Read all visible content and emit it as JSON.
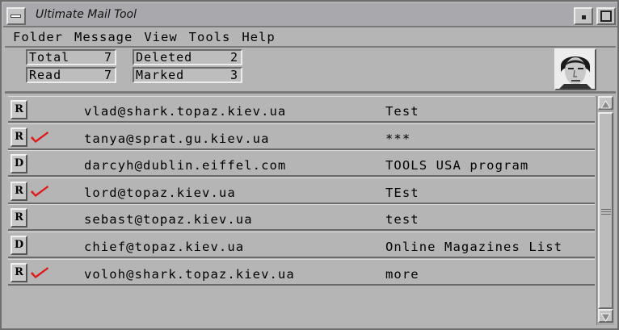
{
  "window": {
    "title": "Ultimate Mail Tool"
  },
  "menu": [
    "Folder",
    "Message",
    "View",
    "Tools",
    "Help"
  ],
  "stats": {
    "total_label": "Total",
    "total_value": "7",
    "deleted_label": "Deleted",
    "deleted_value": "2",
    "read_label": "Read",
    "read_value": "7",
    "marked_label": "Marked",
    "marked_value": "3"
  },
  "messages": [
    {
      "status": "R",
      "marked": false,
      "from": "vlad@shark.topaz.kiev.ua",
      "subject": "Test"
    },
    {
      "status": "R",
      "marked": true,
      "from": "tanya@sprat.gu.kiev.ua",
      "subject": "***"
    },
    {
      "status": "D",
      "marked": false,
      "from": "darcyh@dublin.eiffel.com",
      "subject": "TOOLS USA program"
    },
    {
      "status": "R",
      "marked": true,
      "from": "lord@topaz.kiev.ua",
      "subject": "TEst"
    },
    {
      "status": "R",
      "marked": false,
      "from": "sebast@topaz.kiev.ua",
      "subject": "test"
    },
    {
      "status": "D",
      "marked": false,
      "from": "chief@topaz.kiev.ua",
      "subject": "Online Magazines List"
    },
    {
      "status": "R",
      "marked": true,
      "from": "voloh@shark.topaz.kiev.ua",
      "subject": "more"
    }
  ],
  "colors": {
    "checkmark": "#e01818",
    "background": "#b5b5b5"
  },
  "icons": {
    "mark": "checkmark-icon",
    "avatar": "user-photo"
  }
}
